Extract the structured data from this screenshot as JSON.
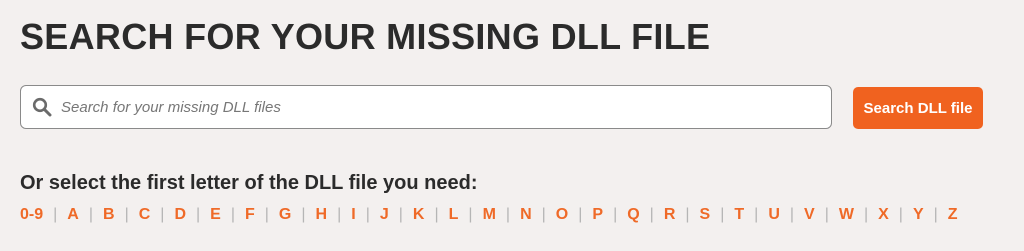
{
  "page": {
    "title": "SEARCH FOR YOUR MISSING DLL FILE"
  },
  "search": {
    "placeholder": "Search for your missing DLL files",
    "value": "",
    "button_label": "Search DLL file",
    "icon": "search-icon"
  },
  "alphabet": {
    "prompt": "Or select the first letter of the DLL file you need:",
    "separator": "|",
    "letters": [
      "0-9",
      "A",
      "B",
      "C",
      "D",
      "E",
      "F",
      "G",
      "H",
      "I",
      "J",
      "K",
      "L",
      "M",
      "N",
      "O",
      "P",
      "Q",
      "R",
      "S",
      "T",
      "U",
      "V",
      "W",
      "X",
      "Y",
      "Z"
    ]
  },
  "colors": {
    "accent": "#f0621f",
    "link": "#ef6a28",
    "background": "#f3f0ef",
    "text": "#2b2b2b"
  }
}
